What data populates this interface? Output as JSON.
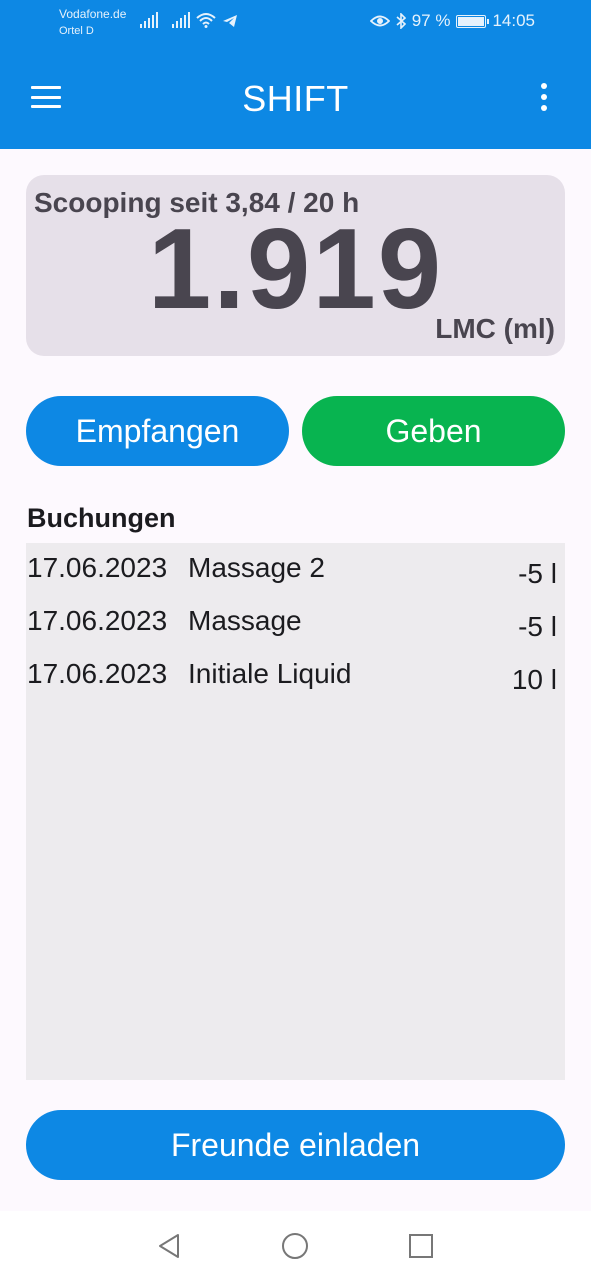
{
  "status_bar": {
    "carrier_line1": "Vodafone.de",
    "carrier_line2": "Ortel D",
    "battery_percent": "97 %",
    "battery_level": 0.97,
    "time": "14:05",
    "icons": [
      "signal-icon",
      "signal-icon",
      "wifi-icon",
      "telegram-icon",
      "eye-icon",
      "bluetooth-icon",
      "battery-icon"
    ]
  },
  "app_bar": {
    "title": "SHIFT",
    "menu_icon": "hamburger-menu-icon",
    "overflow_icon": "more-vertical-icon"
  },
  "balance": {
    "subtitle": "Scooping seit 3,84 / 20 h",
    "amount": "1.919",
    "unit": "LMC (ml)"
  },
  "actions": {
    "receive_label": "Empfangen",
    "give_label": "Geben"
  },
  "bookings": {
    "title": "Buchungen",
    "rows": [
      {
        "date": "17.06.2023",
        "description": "Massage 2",
        "amount": "-5 l"
      },
      {
        "date": "17.06.2023",
        "description": "Massage",
        "amount": "-5 l"
      },
      {
        "date": "17.06.2023",
        "description": "Initiale Liquid",
        "amount": "10 l"
      }
    ]
  },
  "invite": {
    "label": "Freunde einladen"
  },
  "nav": {
    "items": [
      "back-icon",
      "home-icon",
      "recents-icon"
    ]
  },
  "colors": {
    "primary": "#0D88E4",
    "give": "#08B450",
    "card": "#E6E0E9",
    "list_bg": "#EDEBEE"
  }
}
